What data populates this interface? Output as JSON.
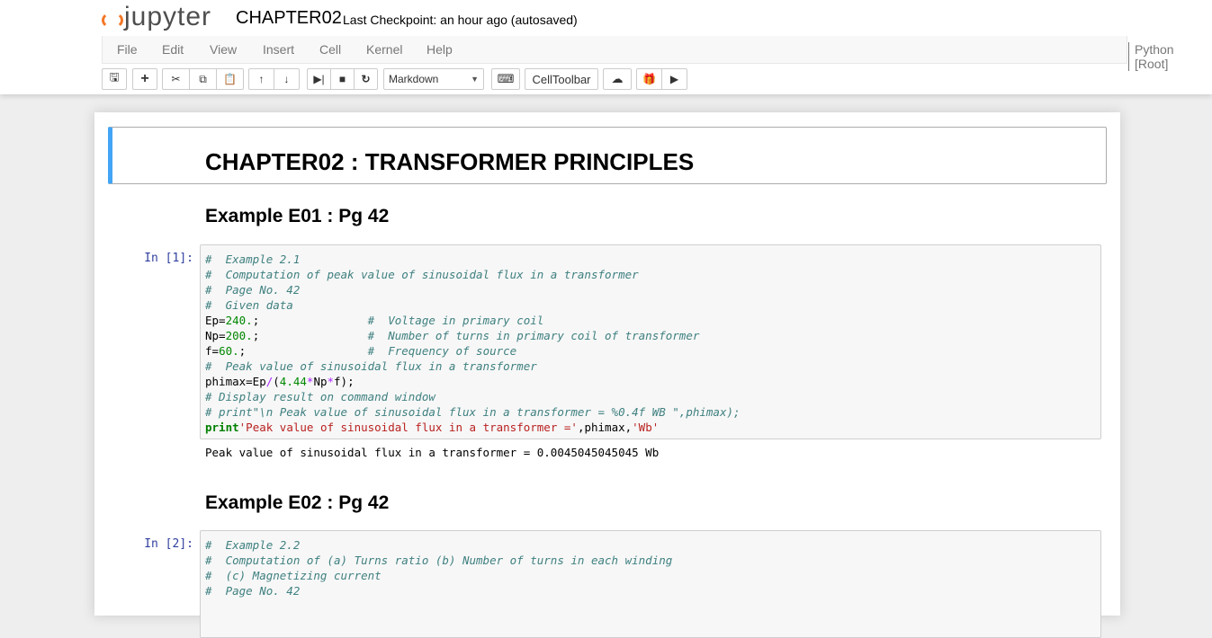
{
  "header": {
    "logo": "jupyter",
    "notebook_name": "CHAPTER02",
    "checkpoint": "Last Checkpoint: an hour ago (autosaved)"
  },
  "menu": [
    "File",
    "Edit",
    "View",
    "Insert",
    "Cell",
    "Kernel",
    "Help"
  ],
  "kernel": "Python [Root]",
  "toolbar": {
    "cell_type": "Markdown",
    "celltoolbar": "CellToolbar",
    "icons": [
      "save-icon",
      "plus-icon",
      "cut-icon",
      "copy-icon",
      "paste-icon",
      "arrow-up-icon",
      "arrow-down-icon",
      "step-forward-icon",
      "stop-icon",
      "restart-icon",
      "keyboard-icon",
      "cloud-upload-icon",
      "gift-icon",
      "play-icon"
    ]
  },
  "notebook": {
    "title": "CHAPTER02 : TRANSFORMER PRINCIPLES",
    "ex1_heading": "Example E01 : Pg 42",
    "ex1_prompt": "In [1]:",
    "ex1_code": [
      [
        [
          "c",
          "#  Example 2.1"
        ]
      ],
      [
        [
          "c",
          "#  Computation of peak value of sinusoidal flux in a transformer"
        ]
      ],
      [
        [
          "c",
          "#  Page No. 42"
        ]
      ],
      [
        [
          "c",
          "#  Given data"
        ]
      ],
      [
        [
          "n",
          "Ep="
        ],
        [
          "m",
          "240."
        ],
        [
          "n",
          ";                "
        ],
        [
          "c",
          "#  Voltage in primary coil"
        ]
      ],
      [
        [
          "n",
          "Np="
        ],
        [
          "m",
          "200."
        ],
        [
          "n",
          ";                "
        ],
        [
          "c",
          "#  Number of turns in primary coil of transformer"
        ]
      ],
      [
        [
          "n",
          "f="
        ],
        [
          "m",
          "60."
        ],
        [
          "n",
          ";                  "
        ],
        [
          "c",
          "#  Frequency of source"
        ]
      ],
      [
        [
          "c",
          "#  Peak value of sinusoidal flux in a transformer"
        ]
      ],
      [
        [
          "n",
          "phimax=Ep"
        ],
        [
          "o",
          "/"
        ],
        [
          "n",
          "("
        ],
        [
          "m",
          "4.44"
        ],
        [
          "o",
          "*"
        ],
        [
          "n",
          "Np"
        ],
        [
          "o",
          "*"
        ],
        [
          "n",
          "f);"
        ]
      ],
      [
        [
          "c",
          "# Display result on command window"
        ]
      ],
      [
        [
          "c",
          "# print\"\\n Peak value of sinusoidal flux in a transformer = %0.4f WB \",phimax);"
        ]
      ],
      [
        [
          "k",
          "print"
        ],
        [
          "s",
          "'Peak value of sinusoidal flux in a transformer ='"
        ],
        [
          "n",
          ",phimax,"
        ],
        [
          "s",
          "'Wb'"
        ]
      ]
    ],
    "ex1_output": "Peak value of sinusoidal flux in a transformer = 0.0045045045045 Wb",
    "ex2_heading": "Example E02 : Pg 42",
    "ex2_prompt": "In [2]:",
    "ex2_code": [
      [
        [
          "c",
          "#  Example 2.2"
        ]
      ],
      [
        [
          "c",
          "#  Computation of (a) Turns ratio (b) Number of turns in each winding"
        ]
      ],
      [
        [
          "c",
          "#  (c) Magnetizing current"
        ]
      ],
      [
        [
          "c",
          "#  Page No. 42"
        ]
      ]
    ]
  }
}
